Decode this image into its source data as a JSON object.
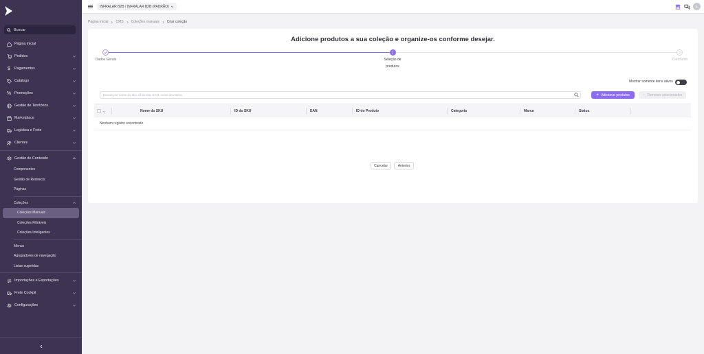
{
  "sidebar": {
    "search_label": "Buscar",
    "items": [
      {
        "label": "Página inicial",
        "icon": "home-icon"
      },
      {
        "label": "Pedidos",
        "icon": "cart-icon"
      },
      {
        "label": "Pagamentos",
        "icon": "dollar-icon"
      },
      {
        "label": "Catálogo",
        "icon": "tag-icon"
      },
      {
        "label": "Promoções",
        "icon": "percent-icon"
      },
      {
        "label": "Gestão de Territórios",
        "icon": "globe-icon"
      },
      {
        "label": "Marketplace",
        "icon": "store-icon"
      },
      {
        "label": "Logística e Frete",
        "icon": "truck-icon"
      },
      {
        "label": "Clientes",
        "icon": "users-icon"
      }
    ],
    "content_group": {
      "label": "Gestão de Conteúdo",
      "icon": "layers-icon",
      "subitems": [
        "Componentes",
        "Gestão de Redirects",
        "Páginas"
      ],
      "collections": {
        "label": "Coleções",
        "subitems": [
          "Coleções Manuais",
          "Coleções Filtráveis",
          "Coleções Inteligentes"
        ],
        "active": "Coleções Manuais"
      },
      "subitems_after": [
        "Menus",
        "Agrupadores de navegação",
        "Listas sugeridas"
      ]
    },
    "bottom_items": [
      {
        "label": "Importações e Exportações",
        "icon": "swap-icon"
      },
      {
        "label": "Frete Cockpit",
        "icon": "truck-icon"
      },
      {
        "label": "Configurações",
        "icon": "gear-icon"
      }
    ]
  },
  "topbar": {
    "account": "INFRALAR B2B / INFRALAR B2B (PADRÃO)",
    "avatar_initials": "IL"
  },
  "breadcrumb": [
    "Página inicial",
    "CMS",
    "Coleções manuais",
    "Criar coleção"
  ],
  "main": {
    "heading": "Adicione produtos a sua coleção e organize-os conforme desejar.",
    "steps": [
      {
        "label": "Dados Gerais",
        "state": "done",
        "number": "1"
      },
      {
        "label": "Seleção de produtos",
        "state": "active",
        "number": "2"
      },
      {
        "label": "Concluído",
        "state": "pending",
        "number": "3"
      }
    ],
    "toggle_label": "Mostrar somente itens ativos",
    "toggle_on": false,
    "search_placeholder": "Buscar por nome do sku, id do sku, EAN, nome da marca",
    "add_button": "Adicionar produtos",
    "remove_button": "Remover selecionados",
    "columns": [
      "Nome do SKU",
      "ID do SKU",
      "EAN",
      "ID do Produto",
      "Categoria",
      "Marca",
      "Status"
    ],
    "empty_text": "Nenhum registro encontrado",
    "cancel_button": "Cancelar",
    "previous_button": "Anterior"
  },
  "colors": {
    "sidebar_bg": "#3e3452",
    "accent": "#8b6cf3",
    "active_item": "#6a5f80"
  }
}
